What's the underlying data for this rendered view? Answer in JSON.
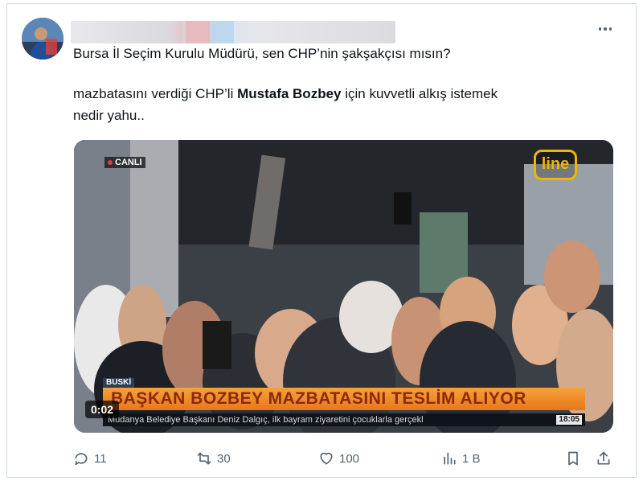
{
  "tweet": {
    "text_line1": "Bursa İl Seçim Kurulu Müdürü, sen CHP’nin şakşakçısı mısın?",
    "text_line2_before": "mazbatasını verdiği  CHP’li ",
    "text_line2_bold": "Mustafa Bozbey",
    "text_line2_after": " için kuvvetli alkış istemek",
    "text_line3": "nedir yahu.."
  },
  "video": {
    "live_label": "CANLI",
    "channel_logo": "line",
    "lower_third_tag": "BUSKİ",
    "lower_third_headline": "BAŞKAN BOZBEY MAZBATASINI TESLİM ALIYOR",
    "ticker_text": "Mudanya Belediye Başkanı Deniz Dalgıç, ilk bayram ziyaretini çocuklarla gerçekl",
    "ticker_time": "18:05",
    "timestamp": "0:02"
  },
  "actions": {
    "replies": "11",
    "reposts": "30",
    "likes": "100",
    "views": "1 B"
  },
  "colors": {
    "icon_gray": "#536471",
    "lower_third_orange": "#e8771b",
    "logo_yellow": "#f0b400"
  }
}
